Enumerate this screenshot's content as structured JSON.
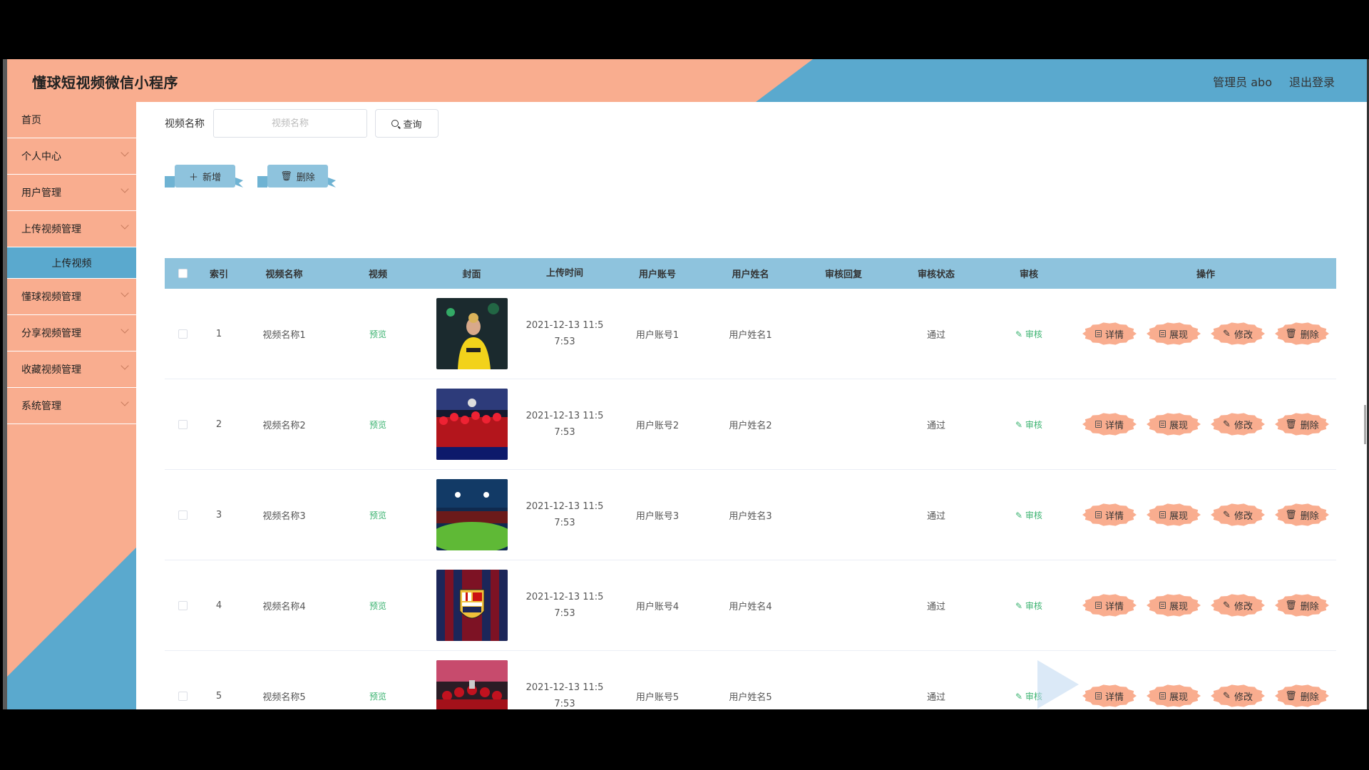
{
  "header": {
    "title": "懂球短视频微信小程序",
    "user_label": "管理员 abo",
    "logout_label": "退出登录",
    "colors": {
      "salmon": "#f9ad8f",
      "blue": "#5aa9ce"
    }
  },
  "sidebar": {
    "items": [
      {
        "label": "首页"
      },
      {
        "label": "个人中心"
      },
      {
        "label": "用户管理"
      },
      {
        "label": "上传视频管理"
      },
      {
        "label": "上传视频"
      },
      {
        "label": "懂球视频管理"
      },
      {
        "label": "分享视频管理"
      },
      {
        "label": "收藏视频管理"
      },
      {
        "label": "系统管理"
      }
    ]
  },
  "search": {
    "label": "视频名称",
    "placeholder": "视频名称",
    "button": "查询"
  },
  "actions": {
    "add": "新增",
    "delete": "删除"
  },
  "table": {
    "headers": {
      "index": "索引",
      "name": "视频名称",
      "video": "视频",
      "cover": "封面",
      "time": "上传时间",
      "account": "用户账号",
      "username": "用户姓名",
      "reply": "审核回复",
      "status": "审核状态",
      "audit": "审核",
      "ops": "操作"
    },
    "op_labels": {
      "detail": "详情",
      "show": "展现",
      "edit": "修改",
      "remove": "删除"
    },
    "preview_label": "预览",
    "audit_label": "审核",
    "rows": [
      {
        "index": "1",
        "name": "视频名称1",
        "time_line1": "2021-12-13 11:5",
        "time_line2": "7:53",
        "account": "用户账号1",
        "username": "用户姓名1",
        "reply": "",
        "status": "通过",
        "cover": "player-yellow"
      },
      {
        "index": "2",
        "name": "视频名称2",
        "time_line1": "2021-12-13 11:5",
        "time_line2": "7:53",
        "account": "用户账号2",
        "username": "用户姓名2",
        "reply": "",
        "status": "通过",
        "cover": "team-celebration"
      },
      {
        "index": "3",
        "name": "视频名称3",
        "time_line1": "2021-12-13 11:5",
        "time_line2": "7:53",
        "account": "用户账号3",
        "username": "用户姓名3",
        "reply": "",
        "status": "通过",
        "cover": "stadium"
      },
      {
        "index": "4",
        "name": "视频名称4",
        "time_line1": "2021-12-13 11:5",
        "time_line2": "7:53",
        "account": "用户账号4",
        "username": "用户姓名4",
        "reply": "",
        "status": "通过",
        "cover": "barcelona-crest"
      },
      {
        "index": "5",
        "name": "视频名称5",
        "time_line1": "2021-12-13 11:5",
        "time_line2": "7:53",
        "account": "用户账号5",
        "username": "用户姓名5",
        "reply": "",
        "status": "通过",
        "cover": "liverpool-trophy"
      }
    ]
  }
}
